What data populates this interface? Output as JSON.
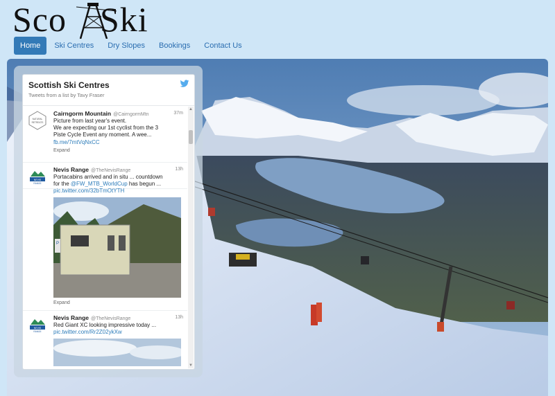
{
  "site": {
    "logo_left": "Sco",
    "logo_right": "Ski"
  },
  "nav": [
    {
      "label": "Home",
      "active": true
    },
    {
      "label": "Ski Centres",
      "active": false
    },
    {
      "label": "Dry Slopes",
      "active": false
    },
    {
      "label": "Bookings",
      "active": false
    },
    {
      "label": "Contact Us",
      "active": false
    }
  ],
  "widget": {
    "title": "Scottish Ski Centres",
    "subtitle": "Tweets from a list by Tavy Fraser",
    "icon": "twitter-bird-icon",
    "tweets": [
      {
        "name": "Cairngorm Mountain",
        "handle": "@CairngormMtn",
        "time": "37m",
        "lines": [
          "Picture from last year's event.",
          "We are expecting our 1st cyclist from the 3",
          "Piste Cycle Event any moment.  A wee..."
        ],
        "link": "fb.me/7mtVqNxCC",
        "expand": "Expand",
        "avatar_text": "NATURAL RETREATS"
      },
      {
        "name": "Nevis Range",
        "handle": "@TheNevisRange",
        "time": "13h",
        "line1": "Portacabins arrived and in situ ... countdown",
        "line2_pre": "for the ",
        "line2_link": "@FW_MTB_WorldCup",
        "line2_post": " has begun ...",
        "link": "pic.twitter.com/32bTmOtYTH",
        "expand": "Expand",
        "avatar_text": "NEVIS RANGE"
      },
      {
        "name": "Nevis Range",
        "handle": "@TheNevisRange",
        "time": "13h",
        "lines": [
          "Red Giant XC looking impressive today ..."
        ],
        "link": "pic.twitter.com/Rr2Z02ykXw",
        "avatar_text": "NEVIS RANGE"
      }
    ]
  },
  "colors": {
    "nav_active": "#337ab7",
    "link": "#2b7bb9",
    "page_bg": "#cfe6f7"
  }
}
